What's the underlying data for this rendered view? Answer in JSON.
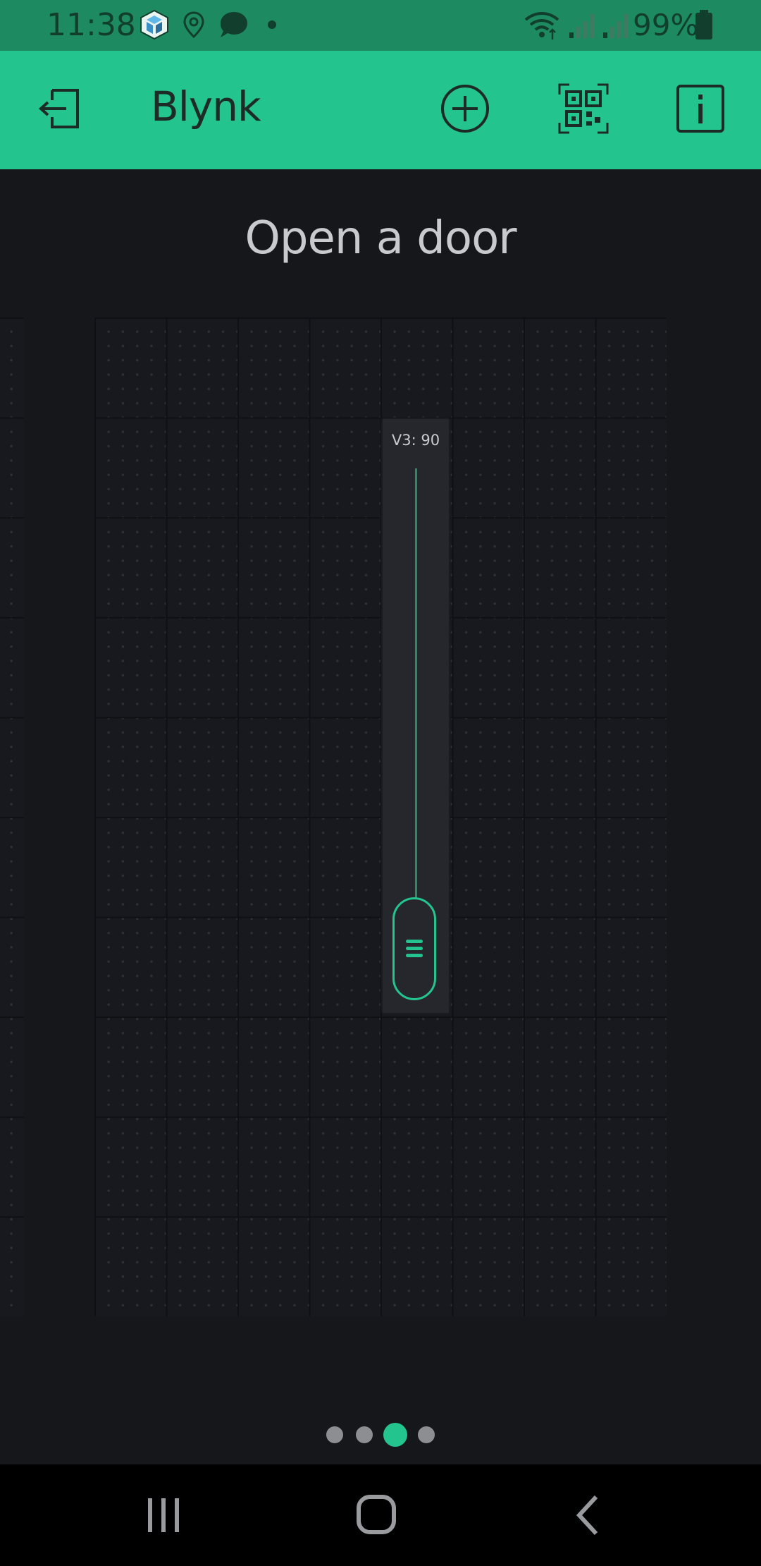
{
  "status_bar": {
    "time": "11:38",
    "battery": "99%",
    "icons": [
      "cube-app-icon",
      "location-icon",
      "chat-bubble-icon",
      "dot-icon",
      "wifi-icon",
      "signal-icon",
      "signal-icon",
      "battery-icon"
    ]
  },
  "app_bar": {
    "title": "Blynk",
    "buttons": [
      "logout-icon",
      "add-circle-icon",
      "qr-code-icon",
      "info-icon"
    ],
    "accent_color": "#24c48e"
  },
  "tab": {
    "title": "Open a door"
  },
  "slider": {
    "label": "V3: 90",
    "pin": "V3",
    "value": 90,
    "track_color": "#2a8a6a",
    "thumb_color": "#24c48e"
  },
  "pager": {
    "count": 4,
    "active_index": 2
  },
  "nav_bar": {
    "buttons": [
      "recent-apps-icon",
      "home-icon",
      "back-icon"
    ]
  }
}
